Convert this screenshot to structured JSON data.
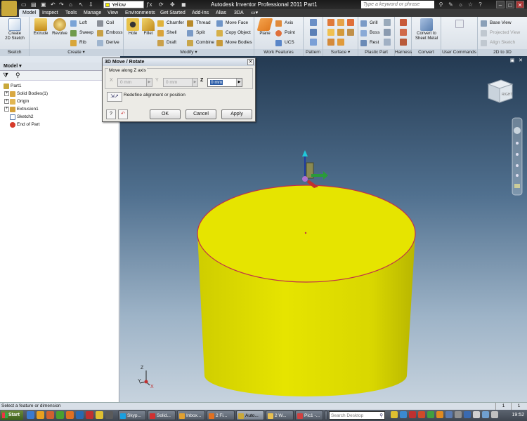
{
  "titlebar": {
    "material": "Yellow",
    "title": "Autodesk Inventor Professional 2011   Part1",
    "search_placeholder": "Type a keyword or phrase",
    "minimize": "–",
    "maximize": "□",
    "close": "✕"
  },
  "ribbon_tabs": [
    "Model",
    "Inspect",
    "Tools",
    "Manage",
    "View",
    "Environments",
    "Get Started",
    "Add-Ins",
    "Alias",
    "3DA"
  ],
  "ribbon": {
    "panels": {
      "sketch": "Sketch",
      "create": "Create",
      "modify": "Modify",
      "work_features": "Work Features",
      "pattern": "Pattern",
      "surface": "Surface",
      "plastic_part": "Plastic Part",
      "harness": "Harness",
      "convert": "Convert",
      "user_commands": "User Commands",
      "to_2d": "2D to 3D"
    },
    "create_2d_sketch": "Create\n2D Sketch",
    "extrude": "Extrude",
    "revolve": "Revolve",
    "loft": "Loft",
    "sweep": "Sweep",
    "rib": "Rib",
    "coil": "Coil",
    "emboss": "Emboss",
    "derive": "Derive",
    "hole": "Hole",
    "fillet": "Fillet",
    "chamfer": "Chamfer",
    "shell": "Shell",
    "draft": "Draft",
    "thread": "Thread",
    "split": "Split",
    "combine": "Combine",
    "move_face": "Move Face",
    "copy_object": "Copy Object",
    "move_bodies": "Move Bodies",
    "plane": "Plane",
    "axis": "Axis",
    "point": "Point",
    "ucs": "UCS",
    "grill": "Grill",
    "boss": "Boss",
    "rest": "Rest",
    "convert_sheet_metal": "Convert to\nSheet Metal",
    "base_view": "Base View",
    "projected_view": "Projected View",
    "align_sketch": "Align Sketch"
  },
  "browser": {
    "header": "Model",
    "items": [
      {
        "label": "Part1"
      },
      {
        "label": "Solid Bodies(1)"
      },
      {
        "label": "Origin"
      },
      {
        "label": "Extrusion1"
      },
      {
        "label": "Sketch2"
      },
      {
        "label": "End of Part"
      }
    ]
  },
  "dialog": {
    "title": "3D Move / Rotate",
    "group_label": "Move along Z axis",
    "x_label": "X",
    "y_label": "Y",
    "z_label": "Z",
    "x_value": "0 mm",
    "y_value": "0 mm",
    "z_value": "0 mm",
    "redefine_label": "Redefine alignment or position",
    "ok": "OK",
    "cancel": "Cancel",
    "apply": "Apply"
  },
  "viewcube": {
    "face": "RIGHT"
  },
  "triad": {
    "x": "X",
    "y": "Y",
    "z": "Z"
  },
  "status": {
    "text": "Select a feature or dimension",
    "count1": "1",
    "count2": "1"
  },
  "taskbar": {
    "start": "Start",
    "tasks": [
      {
        "label": "Skyp..."
      },
      {
        "label": "Solid..."
      },
      {
        "label": "Inbox..."
      },
      {
        "label": "2 Fi..."
      },
      {
        "label": "Auto..."
      },
      {
        "label": "2 W..."
      },
      {
        "label": "Pic1 -..."
      },
      {
        "label": ""
      }
    ],
    "search_placeholder": "Search Desktop",
    "clock": "19:52"
  },
  "colors": {
    "part_yellow": "#e1e000",
    "edge_red": "#c0304a",
    "viewport_top": "#243a52",
    "viewport_bottom": "#c7d3de"
  }
}
